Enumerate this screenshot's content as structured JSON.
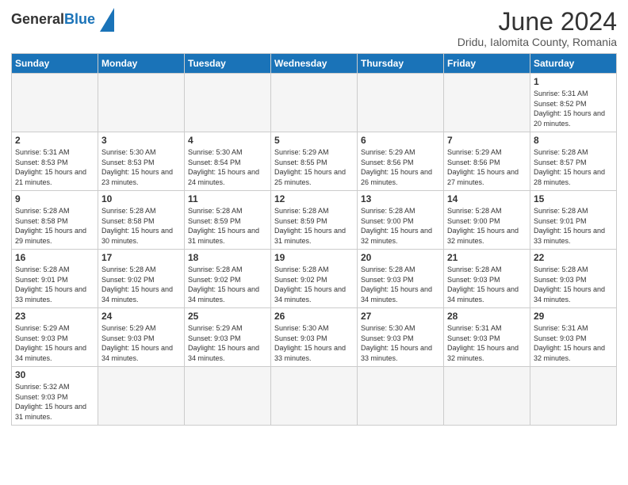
{
  "logo": {
    "text_general": "General",
    "text_blue": "Blue"
  },
  "header": {
    "month_year": "June 2024",
    "location": "Dridu, Ialomita County, Romania"
  },
  "days_of_week": [
    "Sunday",
    "Monday",
    "Tuesday",
    "Wednesday",
    "Thursday",
    "Friday",
    "Saturday"
  ],
  "weeks": [
    [
      {
        "day": null,
        "empty": true
      },
      {
        "day": null,
        "empty": true
      },
      {
        "day": null,
        "empty": true
      },
      {
        "day": null,
        "empty": true
      },
      {
        "day": null,
        "empty": true
      },
      {
        "day": null,
        "empty": true
      },
      {
        "day": 1,
        "sunrise": "5:31 AM",
        "sunset": "8:52 PM",
        "daylight": "15 hours and 20 minutes."
      }
    ],
    [
      {
        "day": 2,
        "sunrise": "5:31 AM",
        "sunset": "8:53 PM",
        "daylight": "15 hours and 21 minutes."
      },
      {
        "day": 3,
        "sunrise": "5:30 AM",
        "sunset": "8:53 PM",
        "daylight": "15 hours and 23 minutes."
      },
      {
        "day": 4,
        "sunrise": "5:30 AM",
        "sunset": "8:54 PM",
        "daylight": "15 hours and 24 minutes."
      },
      {
        "day": 5,
        "sunrise": "5:29 AM",
        "sunset": "8:55 PM",
        "daylight": "15 hours and 25 minutes."
      },
      {
        "day": 6,
        "sunrise": "5:29 AM",
        "sunset": "8:56 PM",
        "daylight": "15 hours and 26 minutes."
      },
      {
        "day": 7,
        "sunrise": "5:29 AM",
        "sunset": "8:56 PM",
        "daylight": "15 hours and 27 minutes."
      },
      {
        "day": 8,
        "sunrise": "5:28 AM",
        "sunset": "8:57 PM",
        "daylight": "15 hours and 28 minutes."
      }
    ],
    [
      {
        "day": 9,
        "sunrise": "5:28 AM",
        "sunset": "8:58 PM",
        "daylight": "15 hours and 29 minutes."
      },
      {
        "day": 10,
        "sunrise": "5:28 AM",
        "sunset": "8:58 PM",
        "daylight": "15 hours and 30 minutes."
      },
      {
        "day": 11,
        "sunrise": "5:28 AM",
        "sunset": "8:59 PM",
        "daylight": "15 hours and 31 minutes."
      },
      {
        "day": 12,
        "sunrise": "5:28 AM",
        "sunset": "8:59 PM",
        "daylight": "15 hours and 31 minutes."
      },
      {
        "day": 13,
        "sunrise": "5:28 AM",
        "sunset": "9:00 PM",
        "daylight": "15 hours and 32 minutes."
      },
      {
        "day": 14,
        "sunrise": "5:28 AM",
        "sunset": "9:00 PM",
        "daylight": "15 hours and 32 minutes."
      },
      {
        "day": 15,
        "sunrise": "5:28 AM",
        "sunset": "9:01 PM",
        "daylight": "15 hours and 33 minutes."
      }
    ],
    [
      {
        "day": 16,
        "sunrise": "5:28 AM",
        "sunset": "9:01 PM",
        "daylight": "15 hours and 33 minutes."
      },
      {
        "day": 17,
        "sunrise": "5:28 AM",
        "sunset": "9:02 PM",
        "daylight": "15 hours and 34 minutes."
      },
      {
        "day": 18,
        "sunrise": "5:28 AM",
        "sunset": "9:02 PM",
        "daylight": "15 hours and 34 minutes."
      },
      {
        "day": 19,
        "sunrise": "5:28 AM",
        "sunset": "9:02 PM",
        "daylight": "15 hours and 34 minutes."
      },
      {
        "day": 20,
        "sunrise": "5:28 AM",
        "sunset": "9:03 PM",
        "daylight": "15 hours and 34 minutes."
      },
      {
        "day": 21,
        "sunrise": "5:28 AM",
        "sunset": "9:03 PM",
        "daylight": "15 hours and 34 minutes."
      },
      {
        "day": 22,
        "sunrise": "5:28 AM",
        "sunset": "9:03 PM",
        "daylight": "15 hours and 34 minutes."
      }
    ],
    [
      {
        "day": 23,
        "sunrise": "5:29 AM",
        "sunset": "9:03 PM",
        "daylight": "15 hours and 34 minutes."
      },
      {
        "day": 24,
        "sunrise": "5:29 AM",
        "sunset": "9:03 PM",
        "daylight": "15 hours and 34 minutes."
      },
      {
        "day": 25,
        "sunrise": "5:29 AM",
        "sunset": "9:03 PM",
        "daylight": "15 hours and 34 minutes."
      },
      {
        "day": 26,
        "sunrise": "5:30 AM",
        "sunset": "9:03 PM",
        "daylight": "15 hours and 33 minutes."
      },
      {
        "day": 27,
        "sunrise": "5:30 AM",
        "sunset": "9:03 PM",
        "daylight": "15 hours and 33 minutes."
      },
      {
        "day": 28,
        "sunrise": "5:31 AM",
        "sunset": "9:03 PM",
        "daylight": "15 hours and 32 minutes."
      },
      {
        "day": 29,
        "sunrise": "5:31 AM",
        "sunset": "9:03 PM",
        "daylight": "15 hours and 32 minutes."
      }
    ],
    [
      {
        "day": 30,
        "sunrise": "5:32 AM",
        "sunset": "9:03 PM",
        "daylight": "15 hours and 31 minutes."
      },
      {
        "day": null,
        "empty": true
      },
      {
        "day": null,
        "empty": true
      },
      {
        "day": null,
        "empty": true
      },
      {
        "day": null,
        "empty": true
      },
      {
        "day": null,
        "empty": true
      },
      {
        "day": null,
        "empty": true
      }
    ]
  ]
}
